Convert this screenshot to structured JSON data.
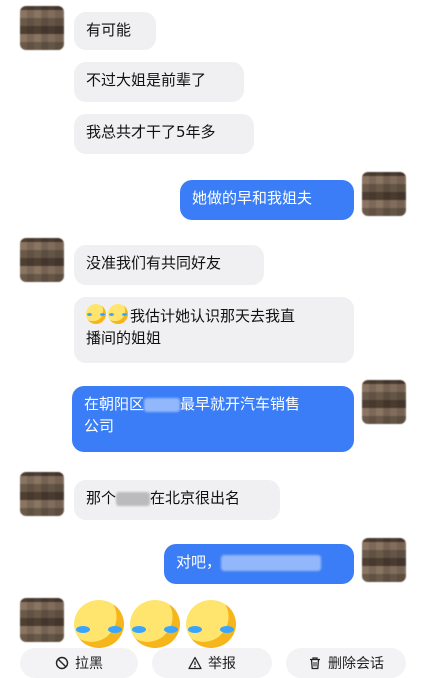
{
  "messages": {
    "m1": "有可能",
    "m2": "不过大姐是前辈了",
    "m3": "我总共才干了5年多",
    "m4": "她做的早和我姐夫",
    "m5": "没准我们有共同好友",
    "m6a": "我估计她认识那天去我直",
    "m6b": "播间的姐姐",
    "m7a_pre": "在朝阳区",
    "m7a_post": "最早就开汽车销售",
    "m7b": "公司",
    "m8_pre": "那个",
    "m8_post": "在北京很出名",
    "m9_pre": "对吧，"
  },
  "actions": {
    "block": "拉黑",
    "report": "举报",
    "delete": "删除会话"
  },
  "colors": {
    "outgoing_bubble": "#3a7df6",
    "incoming_bubble": "#f0f0f3"
  },
  "icons": {
    "block": "ban-icon",
    "report": "warning-icon",
    "delete": "trash-icon"
  }
}
